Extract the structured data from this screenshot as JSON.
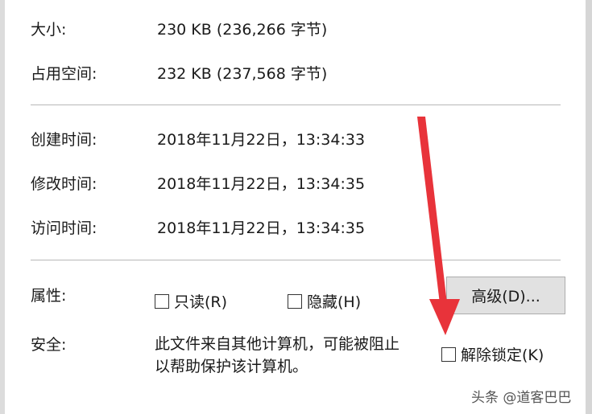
{
  "size": {
    "label": "大小:",
    "value": "230 KB (236,266 字节)"
  },
  "size_on_disk": {
    "label": "占用空间:",
    "value": "232 KB (237,568 字节)"
  },
  "created": {
    "label": "创建时间:",
    "value": "2018年11月22日，13:34:33"
  },
  "modified": {
    "label": "修改时间:",
    "value": "2018年11月22日，13:34:35"
  },
  "accessed": {
    "label": "访问时间:",
    "value": "2018年11月22日，13:34:35"
  },
  "attributes": {
    "label": "属性:",
    "readonly_label": "只读(R)",
    "readonly_checked": false,
    "hidden_label": "隐藏(H)",
    "hidden_checked": false,
    "advanced_button": "高级(D)..."
  },
  "security": {
    "label": "安全:",
    "message_line1": "此文件来自其他计算机，可能被阻止",
    "message_line2": "以帮助保护该计算机。",
    "unblock_label": "解除锁定(K)",
    "unblock_checked": false
  },
  "watermark": "头条 @道客巴巴",
  "colors": {
    "arrow": "#e8333a",
    "button_bg": "#e1e1e1",
    "divider": "#b8b8b8"
  }
}
